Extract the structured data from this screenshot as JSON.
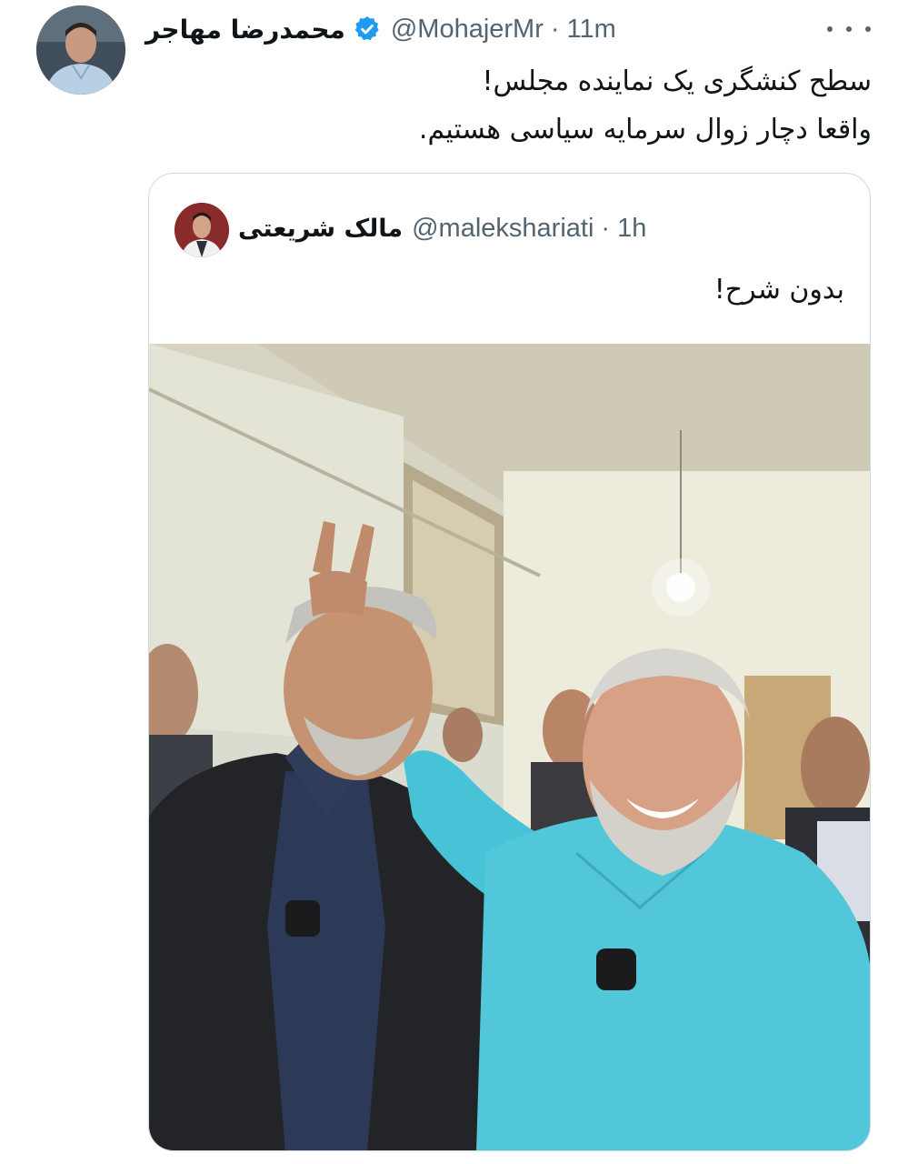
{
  "tweet": {
    "author": {
      "display_name": "محمدرضا مهاجر",
      "handle": "@MohajerMr",
      "time": "11m",
      "verified": true
    },
    "separator": "·",
    "text_lines": [
      "سطح کنشگری یک نماینده مجلس!",
      "واقعا دچار زوال سرمایه سیاسی هستیم."
    ],
    "more_icon": "more-horizontal-icon"
  },
  "quote": {
    "author": {
      "display_name": "مالک شریعتی",
      "handle": "@malekshariati",
      "time": "1h"
    },
    "separator": "·",
    "text": "بدون شرح!",
    "media": {
      "type": "photo",
      "description_icon": "photo-icon"
    }
  },
  "colors": {
    "text_primary": "#0f1419",
    "text_secondary": "#536471",
    "border": "#cfd9de",
    "verified_blue": "#1d9bf0"
  }
}
